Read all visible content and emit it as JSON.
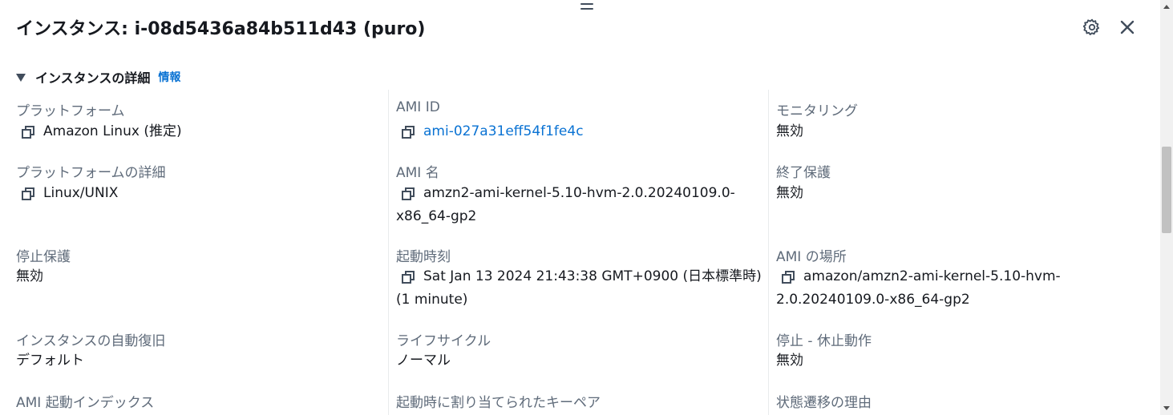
{
  "header": {
    "title": "インスタンス: i-08d5436a84b511d43 (puro)"
  },
  "section": {
    "title": "インスタンスの詳細",
    "info_link": "情報"
  },
  "fields": {
    "platform": {
      "label": "プラットフォーム",
      "value": "Amazon Linux (推定)"
    },
    "platform_details": {
      "label": "プラットフォームの詳細",
      "value": "Linux/UNIX"
    },
    "stop_protection": {
      "label": "停止保護",
      "value": "無効"
    },
    "auto_recovery": {
      "label": "インスタンスの自動復旧",
      "value": "デフォルト"
    },
    "ami_launch_index": {
      "label": "AMI 起動インデックス"
    },
    "ami_id": {
      "label": "AMI ID",
      "value": "ami-027a31eff54f1fe4c"
    },
    "ami_name": {
      "label": "AMI 名",
      "value_line1": "amzn2-ami-kernel-5.10-hvm-2.0.20240109.0-",
      "value_line2": "x86_64-gp2"
    },
    "launch_time": {
      "label": "起動時刻",
      "value_line1": "Sat Jan 13 2024 21:43:38 GMT+0900 (日本標準時)",
      "value_line2": "(1 minute)"
    },
    "lifecycle": {
      "label": "ライフサイクル",
      "value": "ノーマル"
    },
    "key_pair": {
      "label": "起動時に割り当てられたキーペア"
    },
    "monitoring": {
      "label": "モニタリング",
      "value": "無効"
    },
    "termination_protection": {
      "label": "終了保護",
      "value": "無効"
    },
    "ami_location": {
      "label": "AMI の場所",
      "value_line1": "amazon/amzn2-ami-kernel-5.10-hvm-",
      "value_line2": "2.0.20240109.0-x86_64-gp2"
    },
    "stop_hibernate": {
      "label": "停止 - 休止動作",
      "value": "無効"
    },
    "state_transition_reason": {
      "label": "状態遷移の理由"
    }
  },
  "icons": {
    "copy": "copy-icon",
    "gear": "gear-icon",
    "close": "close-icon",
    "caret": "caret-down-icon",
    "drag": "drag-handle-icon"
  },
  "colors": {
    "link": "#0972d3",
    "label": "#5f6b7a",
    "text": "#16191f"
  }
}
